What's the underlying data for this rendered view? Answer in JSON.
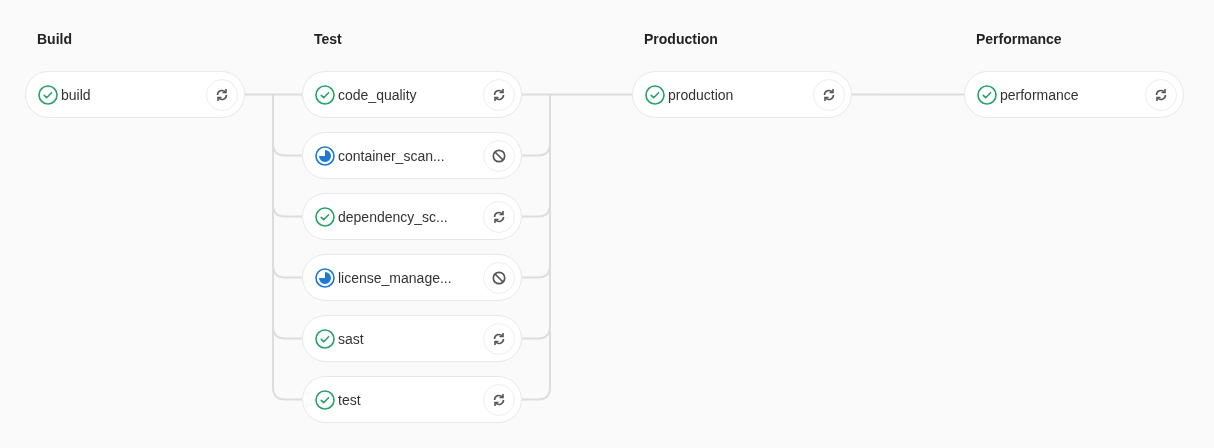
{
  "stages": [
    {
      "title": "Build",
      "jobs": [
        {
          "name": "build",
          "kind": "success"
        }
      ]
    },
    {
      "title": "Test",
      "jobs": [
        {
          "name": "code_quality",
          "kind": "success"
        },
        {
          "name": "container_scan...",
          "kind": "running"
        },
        {
          "name": "dependency_sc...",
          "kind": "success"
        },
        {
          "name": "license_manage...",
          "kind": "running"
        },
        {
          "name": "sast",
          "kind": "success"
        },
        {
          "name": "test",
          "kind": "success"
        }
      ]
    },
    {
      "title": "Production",
      "jobs": [
        {
          "name": "production",
          "kind": "success"
        }
      ]
    },
    {
      "title": "Performance",
      "jobs": [
        {
          "name": "performance",
          "kind": "success"
        }
      ]
    }
  ]
}
